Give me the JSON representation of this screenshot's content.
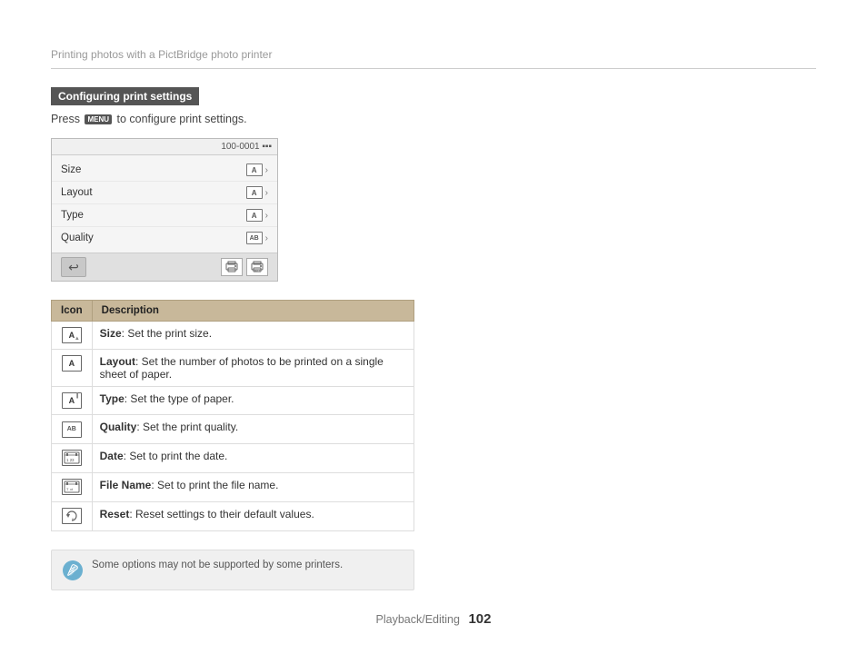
{
  "header": {
    "title": "Printing photos with a PictBridge photo printer"
  },
  "section": {
    "heading": "Configuring print settings",
    "instruction": "Press",
    "instruction_menu": "MENU",
    "instruction_suffix": "to configure print settings."
  },
  "camera_ui": {
    "topbar": "100-0001",
    "menu_items": [
      {
        "label": "Size",
        "icon": "A"
      },
      {
        "label": "Layout",
        "icon": "A"
      },
      {
        "label": "Type",
        "icon": "A"
      },
      {
        "label": "Quality",
        "icon": "AB"
      }
    ],
    "back_symbol": "↩"
  },
  "table": {
    "headers": [
      "Icon",
      "Description"
    ],
    "rows": [
      {
        "icon_type": "size",
        "icon_label": "A",
        "desc_bold": "Size",
        "desc": ": Set the print size."
      },
      {
        "icon_type": "layout",
        "icon_label": "A",
        "desc_bold": "Layout",
        "desc": ": Set the number of photos to be printed on a single sheet of paper."
      },
      {
        "icon_type": "type",
        "icon_label": "A",
        "desc_bold": "Type",
        "desc": ": Set the type of paper."
      },
      {
        "icon_type": "quality",
        "icon_label": "AB",
        "desc_bold": "Quality",
        "desc": ": Set the print quality."
      },
      {
        "icon_type": "date",
        "icon_label": "d",
        "desc_bold": "Date",
        "desc": ": Set to print the date."
      },
      {
        "icon_type": "filename",
        "icon_label": "f",
        "desc_bold": "File Name",
        "desc": ": Set to print the file name."
      },
      {
        "icon_type": "reset",
        "icon_label": "r",
        "desc_bold": "Reset",
        "desc": ": Reset settings to their default values."
      }
    ]
  },
  "note": {
    "text": "Some options may not be supported by some printers."
  },
  "footer": {
    "label": "Playback/Editing",
    "page": "102"
  }
}
